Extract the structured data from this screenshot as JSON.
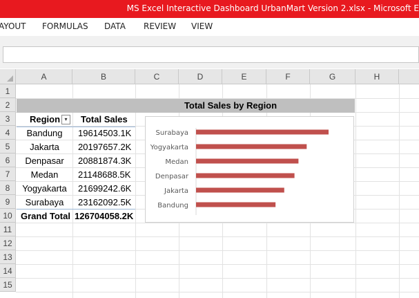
{
  "window": {
    "title": "MS Excel Interactive Dashboard UrbanMart Version 2.xlsx  -  Microsoft E"
  },
  "ribbon": {
    "tabs": [
      "AYOUT",
      "FORMULAS",
      "DATA",
      "REVIEW",
      "VIEW"
    ]
  },
  "sheet": {
    "columns": [
      "A",
      "B",
      "C",
      "D",
      "E",
      "F",
      "G",
      "H"
    ],
    "rows": [
      "1",
      "2",
      "3",
      "4",
      "5",
      "6",
      "7",
      "8",
      "9",
      "10",
      "11",
      "12",
      "13",
      "14",
      "15"
    ],
    "merged_title": "Total Sales by Region"
  },
  "pivot": {
    "headers": {
      "region": "Region",
      "sales": "Total Sales"
    },
    "rows": [
      {
        "region": "Bandung",
        "sales": "19614503.1K"
      },
      {
        "region": "Jakarta",
        "sales": "20197657.2K"
      },
      {
        "region": "Denpasar",
        "sales": "20881874.3K"
      },
      {
        "region": "Medan",
        "sales": "21148688.5K"
      },
      {
        "region": "Yogyakarta",
        "sales": "21699242.6K"
      },
      {
        "region": "Surabaya",
        "sales": "23162092.5K"
      }
    ],
    "grand_total": {
      "label": "Grand Total",
      "value": "126704058.2K"
    }
  },
  "chart_data": {
    "type": "bar",
    "orientation": "horizontal",
    "categories": [
      "Surabaya",
      "Yogyakarta",
      "Medan",
      "Denpasar",
      "Jakarta",
      "Bandung"
    ],
    "values": [
      23162092.5,
      21699242.6,
      21148688.5,
      20881874.3,
      20197657.2,
      19614503.1
    ],
    "baseline": 14300000,
    "bar_color": "#c0504d",
    "grid": false,
    "legend": "none"
  }
}
